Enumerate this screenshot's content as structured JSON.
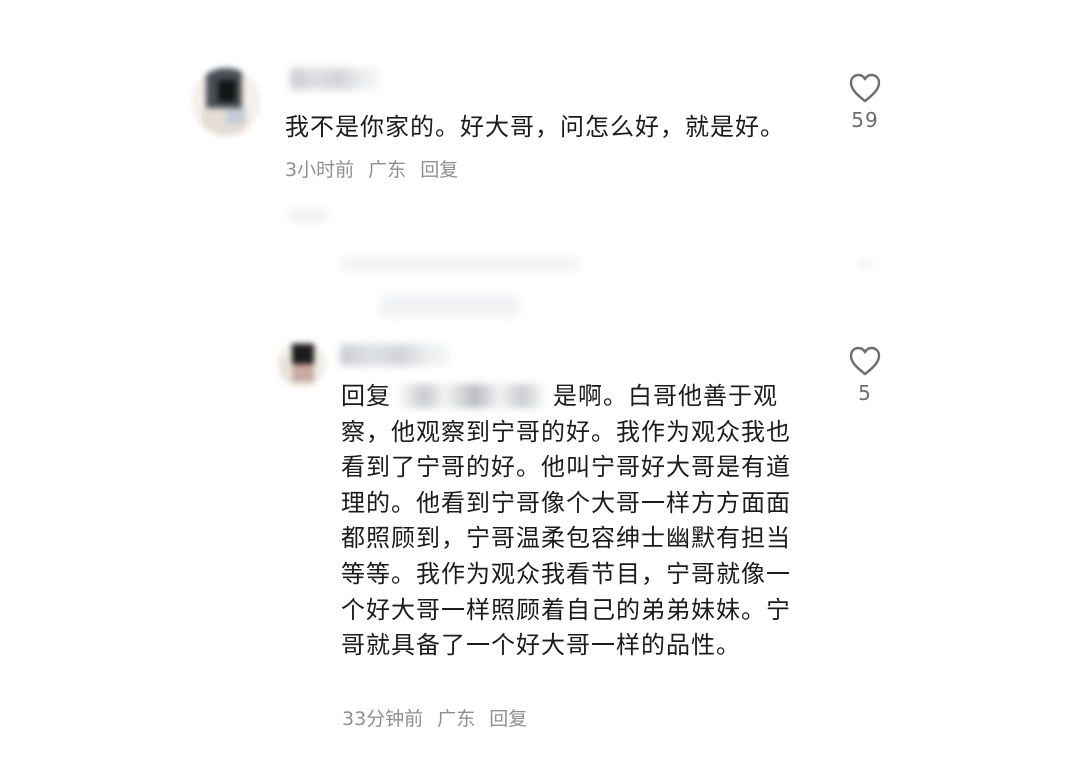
{
  "comments": [
    {
      "text": "我不是你家的。好大哥，问怎么好，就是好。",
      "time": "3小时前",
      "location": "广东",
      "reply_label": "回复",
      "likes": "59"
    },
    {
      "reply_prefix": "回复",
      "text": "是啊。白哥他善于观察，他观察到宁哥的好。我作为观众我也看到了宁哥的好。他叫宁哥好大哥是有道理的。他看到宁哥像个大哥一样方方面面都照顾到，宁哥温柔包容绅士幽默有担当等等。我作为观众我看节目，宁哥就像一个好大哥一样照顾着自己的弟弟妹妹。宁哥就具备了一个好大哥一样的品性。",
      "time": "33分钟前",
      "location": "广东",
      "reply_label": "回复",
      "likes": "5"
    }
  ],
  "icons": {
    "like": "heart-outline-icon"
  },
  "colors": {
    "text": "#1b1b1b",
    "meta": "#8f8f8f",
    "icon": "#6d6d6d"
  }
}
